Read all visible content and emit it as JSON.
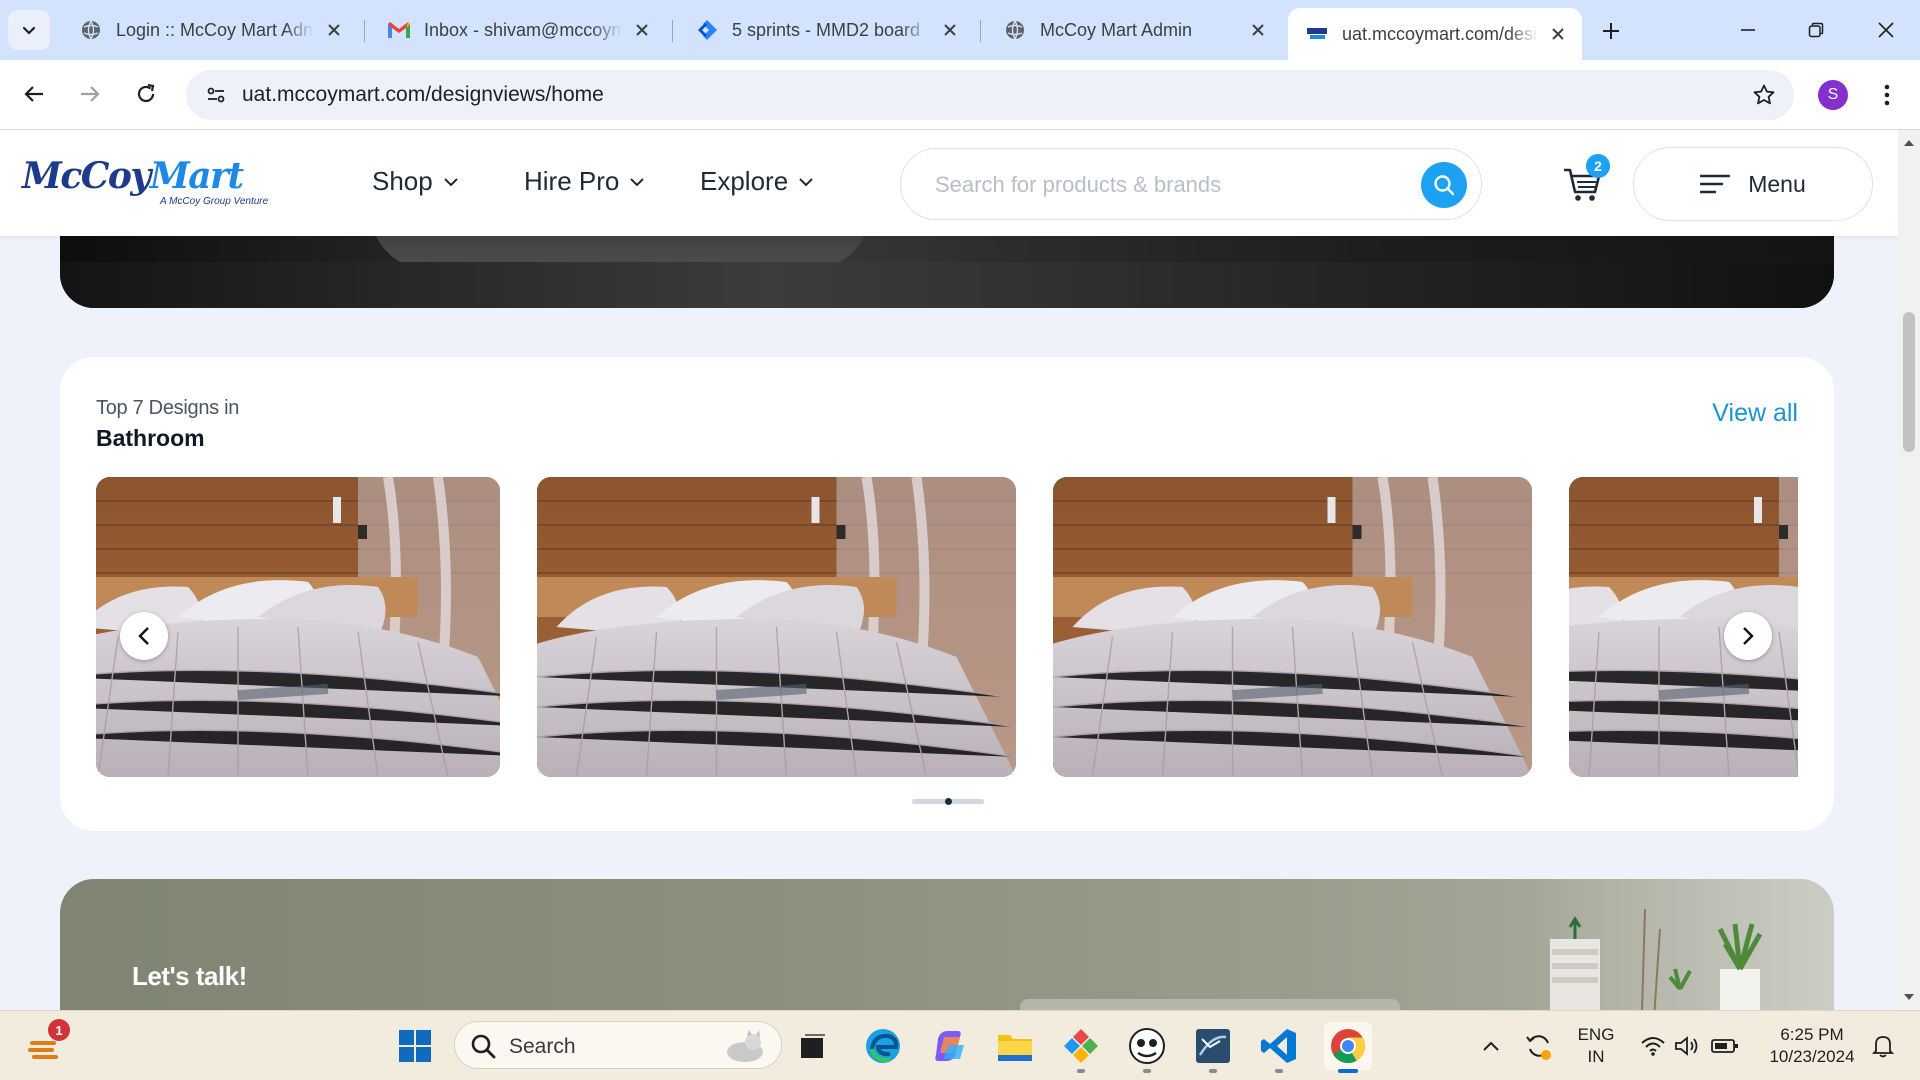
{
  "browser": {
    "tabs": [
      {
        "title": "Login :: McCoy Mart Adm",
        "favicon": "globe-icon",
        "active": false
      },
      {
        "title": "Inbox - shivam@mccoym",
        "favicon": "gmail-icon",
        "active": false
      },
      {
        "title": "5 sprints - MMD2 board",
        "favicon": "jira-icon",
        "active": false
      },
      {
        "title": "McCoy Mart Admin",
        "favicon": "globe-icon",
        "active": false
      },
      {
        "title": "uat.mccoymart.com/desi",
        "favicon": "mccoy-favicon",
        "active": true
      }
    ],
    "url": "uat.mccoymart.com/designviews/home",
    "profile_initial": "S",
    "colors": {
      "tabstrip": "#d3e3fd",
      "omnibox": "#eef2f8",
      "profile": "#8430ce"
    }
  },
  "site": {
    "logo": {
      "brand_a": "McCoy",
      "brand_b": "Mart",
      "tagline": "A McCoy Group Venture"
    },
    "nav": [
      {
        "label": "Shop"
      },
      {
        "label": "Hire Pro"
      },
      {
        "label": "Explore"
      }
    ],
    "search": {
      "placeholder": "Search for products & brands"
    },
    "cart_count": "2",
    "menu_label": "Menu",
    "accent_color": "#1da1f2"
  },
  "designs": {
    "subtitle": "Top 7 Designs in",
    "category": "Bathroom",
    "view_all": "View all",
    "slides": [
      {
        "image": "bedroom-photo"
      },
      {
        "image": "bedroom-photo"
      },
      {
        "image": "bedroom-photo"
      },
      {
        "image": "bedroom-photo"
      }
    ],
    "page_indicator_active": 2
  },
  "talk_banner": {
    "heading": "Let's talk!"
  },
  "taskbar": {
    "search_label": "Search",
    "notification_badge": "1",
    "language_line1": "ENG",
    "language_line2": "IN",
    "time": "6:25 PM",
    "date": "10/23/2024",
    "apps": [
      "start-icon",
      "task-view-icon",
      "edge-icon",
      "copilot-icon",
      "file-explorer-icon",
      "app-icon",
      "avatar-app-icon",
      "network-tool-icon",
      "vscode-icon",
      "chrome-icon"
    ]
  }
}
